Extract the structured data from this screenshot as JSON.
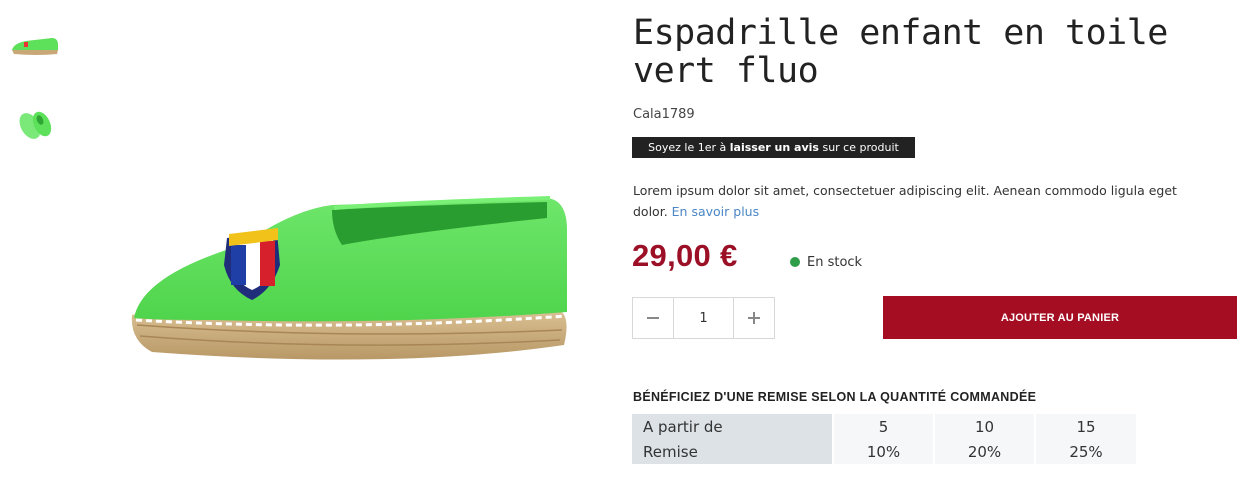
{
  "gallery": {
    "thumbnails": [
      {
        "icon": "espadrille-side-thumbnail"
      },
      {
        "icon": "espadrille-pair-thumbnail"
      }
    ],
    "main_image": {
      "icon": "green-espadrille-image"
    }
  },
  "product": {
    "title": "Espadrille enfant en toile vert fluo",
    "reference": "Cala1789",
    "review_prefix": "Soyez le 1er à ",
    "review_link": "laisser un avis",
    "review_suffix": " sur ce produit",
    "description": "Lorem ipsum dolor sit amet, consectetuer adipiscing elit. Aenean commodo ligula eget dolor.",
    "read_more": "En savoir plus",
    "price": "29,00 €",
    "stock": "En stock",
    "quantity": "1",
    "add_to_cart": "AJOUTER AU PANIER"
  },
  "discount": {
    "title": "BÉNÉFICIEZ D'UNE REMISE SELON LA QUANTITÉ COMMANDÉE",
    "row_qty_label": "A partir de",
    "row_discount_label": "Remise",
    "quantities": [
      "5",
      "10",
      "15"
    ],
    "discounts": [
      "10%",
      "20%",
      "25%"
    ]
  },
  "colors": {
    "accent": "#a50d22",
    "price": "#9b1027",
    "stock": "#2e9e4a",
    "shoe": "#5de05a"
  }
}
